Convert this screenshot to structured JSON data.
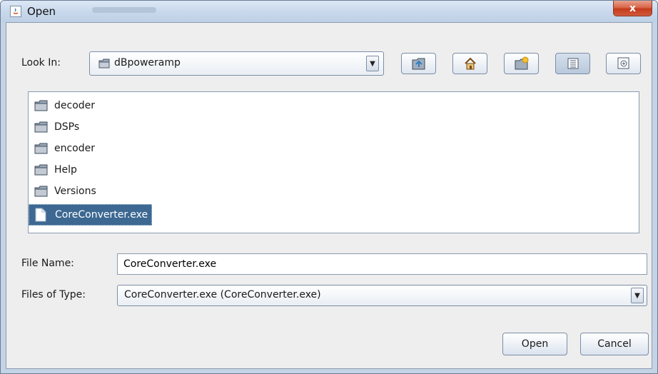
{
  "window": {
    "title": "Open",
    "close_label": "x"
  },
  "look_in": {
    "label": "Look In:",
    "value": "dBpoweramp"
  },
  "toolbar": {
    "buttons": [
      {
        "name": "up-one-level",
        "icon": "folder-up-icon"
      },
      {
        "name": "home",
        "icon": "home-icon"
      },
      {
        "name": "create-new-folder",
        "icon": "new-folder-icon"
      },
      {
        "name": "list-view",
        "icon": "list-view-icon"
      },
      {
        "name": "details-view",
        "icon": "details-view-icon"
      }
    ]
  },
  "files": [
    {
      "name": "decoder",
      "type": "folder"
    },
    {
      "name": "DSPs",
      "type": "folder"
    },
    {
      "name": "encoder",
      "type": "folder"
    },
    {
      "name": "Help",
      "type": "folder"
    },
    {
      "name": "Versions",
      "type": "folder"
    },
    {
      "name": "CoreConverter.exe",
      "type": "file",
      "selected": true
    }
  ],
  "file_name": {
    "label": "File Name:",
    "value": "CoreConverter.exe"
  },
  "files_of_type": {
    "label": "Files of Type:",
    "value": "CoreConverter.exe (CoreConverter.exe)"
  },
  "buttons": {
    "open": "Open",
    "cancel": "Cancel"
  },
  "colors": {
    "selection": "#3c6892",
    "frame": "#c4d3e6",
    "close": "#c43b1c"
  }
}
